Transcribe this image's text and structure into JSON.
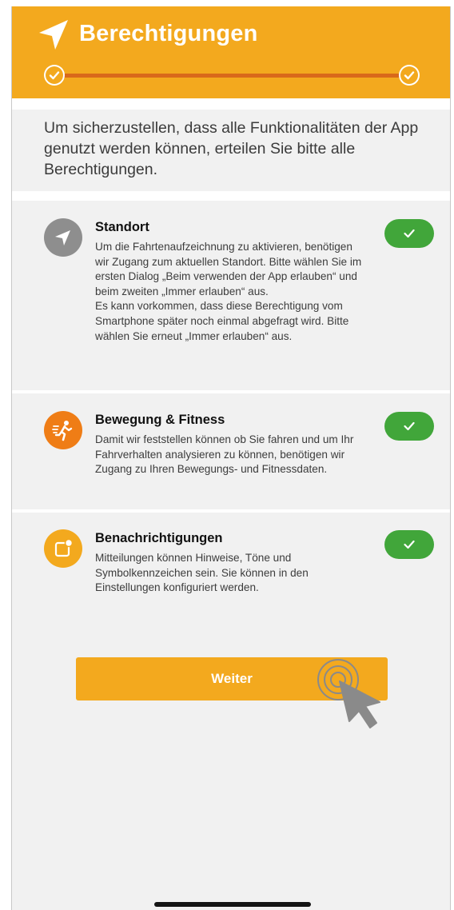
{
  "header": {
    "title": "Berechtigungen",
    "icon": "location-arrow-icon",
    "progress_steps": 2,
    "progress_completed": 2
  },
  "intro": {
    "text": "Um sicherzustellen, dass alle Funktionalitäten der App genutzt werden können, erteilen Sie bitte alle Berechtigungen."
  },
  "permissions": [
    {
      "title": "Standort",
      "text": "Um die Fahrtenaufzeichnung zu aktivieren, benötigen wir Zugang zum aktuellen Standort. Bitte wählen Sie im ersten Dialog „Beim verwenden der App erlauben“ und beim zweiten „Immer erlauben“ aus.\nEs kann vorkommen, dass diese Berechtigung vom Smartphone später noch einmal abgefragt wird. Bitte wählen Sie erneut „Immer erlauben“ aus.",
      "icon": "location-arrow-icon",
      "icon_color": "#8e8e8e",
      "granted": true
    },
    {
      "title": "Bewegung & Fitness",
      "text": "Damit wir feststellen können ob Sie fahren und um Ihr Fahrverhalten analysieren zu können, benötigen wir Zugang zu Ihren Bewegungs- und Fitnessdaten.",
      "icon": "running-person-icon",
      "icon_color": "#ef7d16",
      "granted": true
    },
    {
      "title": "Benachrichtigungen",
      "text": "Mitteilungen können Hinweise, Töne und Symbolkennzeichen sein. Sie können in den Einstellungen konfiguriert werden.",
      "icon": "notification-badge-icon",
      "icon_color": "#f3a91e",
      "granted": true
    }
  ],
  "button": {
    "label": "Weiter"
  },
  "colors": {
    "accent": "#f3a91e",
    "progress": "#d9691a",
    "granted": "#41a63a",
    "background": "#f1f1f1"
  }
}
